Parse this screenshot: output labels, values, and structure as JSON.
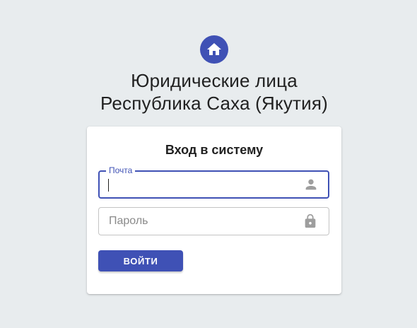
{
  "header": {
    "logo_icon": "home-icon",
    "title_line1": "Юридические лица",
    "title_line2": "Республика Саха (Якутия)"
  },
  "login": {
    "title": "Вход в систему",
    "email": {
      "label": "Почта",
      "value": "",
      "icon": "person-icon",
      "focused": true
    },
    "password": {
      "placeholder": "Пароль",
      "value": "",
      "icon": "lock-icon"
    },
    "submit_label": "ВОЙТИ"
  },
  "colors": {
    "accent": "#3f51b5",
    "background": "#e8ecee",
    "card": "#ffffff",
    "icon_gray": "#9e9e9e"
  }
}
